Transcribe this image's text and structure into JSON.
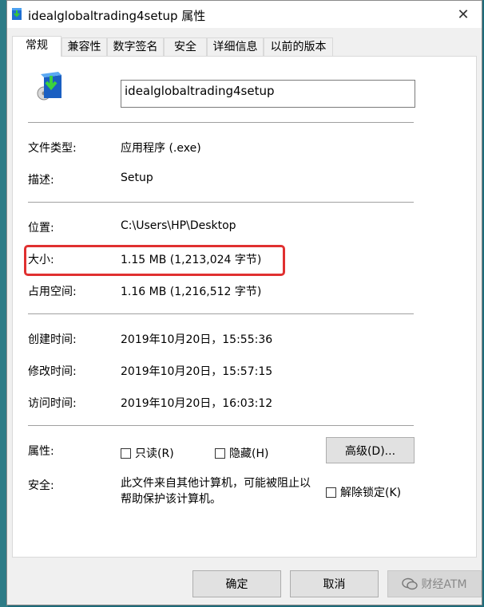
{
  "window": {
    "title": "idealglobaltrading4setup 属性",
    "close_glyph": "✕"
  },
  "tabs": [
    {
      "label": "常规",
      "active": true
    },
    {
      "label": "兼容性"
    },
    {
      "label": "数字签名"
    },
    {
      "label": "安全"
    },
    {
      "label": "详细信息"
    },
    {
      "label": "以前的版本"
    }
  ],
  "general": {
    "file_name": "idealglobaltrading4setup",
    "file_type_label": "文件类型:",
    "file_type_value": "应用程序 (.exe)",
    "description_label": "描述:",
    "description_value": "Setup",
    "location_label": "位置:",
    "location_value": "C:\\Users\\HP\\Desktop",
    "size_label": "大小:",
    "size_value": "1.15 MB (1,213,024 字节)",
    "size_on_disk_label": "占用空间:",
    "size_on_disk_value": "1.16 MB (1,216,512 字节)",
    "created_label": "创建时间:",
    "created_value": "2019年10月20日，15:55:36",
    "modified_label": "修改时间:",
    "modified_value": "2019年10月20日，15:57:15",
    "accessed_label": "访问时间:",
    "accessed_value": "2019年10月20日，16:03:12",
    "attributes_label": "属性:",
    "readonly_label": "只读(R)",
    "hidden_label": "隐藏(H)",
    "advanced_button": "高级(D)...",
    "security_label": "安全:",
    "security_text": "此文件来自其他计算机，可能被阻止以帮助保护该计算机。",
    "unblock_label": "解除锁定(K)"
  },
  "buttons": {
    "ok": "确定",
    "cancel": "取消"
  },
  "watermark": {
    "text": "财经ATM"
  },
  "colors": {
    "highlight_border": "#e03030",
    "desktop_background": "#1e6b7a"
  }
}
